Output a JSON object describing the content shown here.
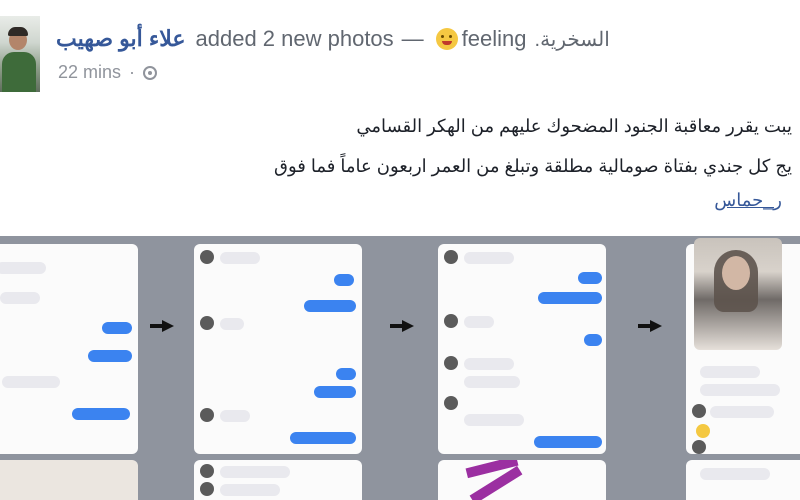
{
  "post": {
    "author": "علاء أبو صهيب",
    "action": "added 2 new photos",
    "separator": "—",
    "feeling_prefix": "feeling",
    "feeling_value": "السخرية.",
    "timestamp": "22 mins",
    "dot": "·",
    "text_line1": "يبت يقرر معاقبة الجنود المضحوك عليهم من الهكر القسامي",
    "text_line2": "يج كل جندي بفتاة صومالية مطلقة وتبلغ من العمر اربعون عاماً فما فوق",
    "hashtag": "ر_حماس"
  },
  "icons": {
    "globe": "globe-icon",
    "feeling": "feeling-emoji-icon",
    "arrow": "right-arrow-icon"
  },
  "colors": {
    "author": "#365899",
    "bubble_blue": "#3b83f0",
    "photo_bg": "#8f949e"
  }
}
